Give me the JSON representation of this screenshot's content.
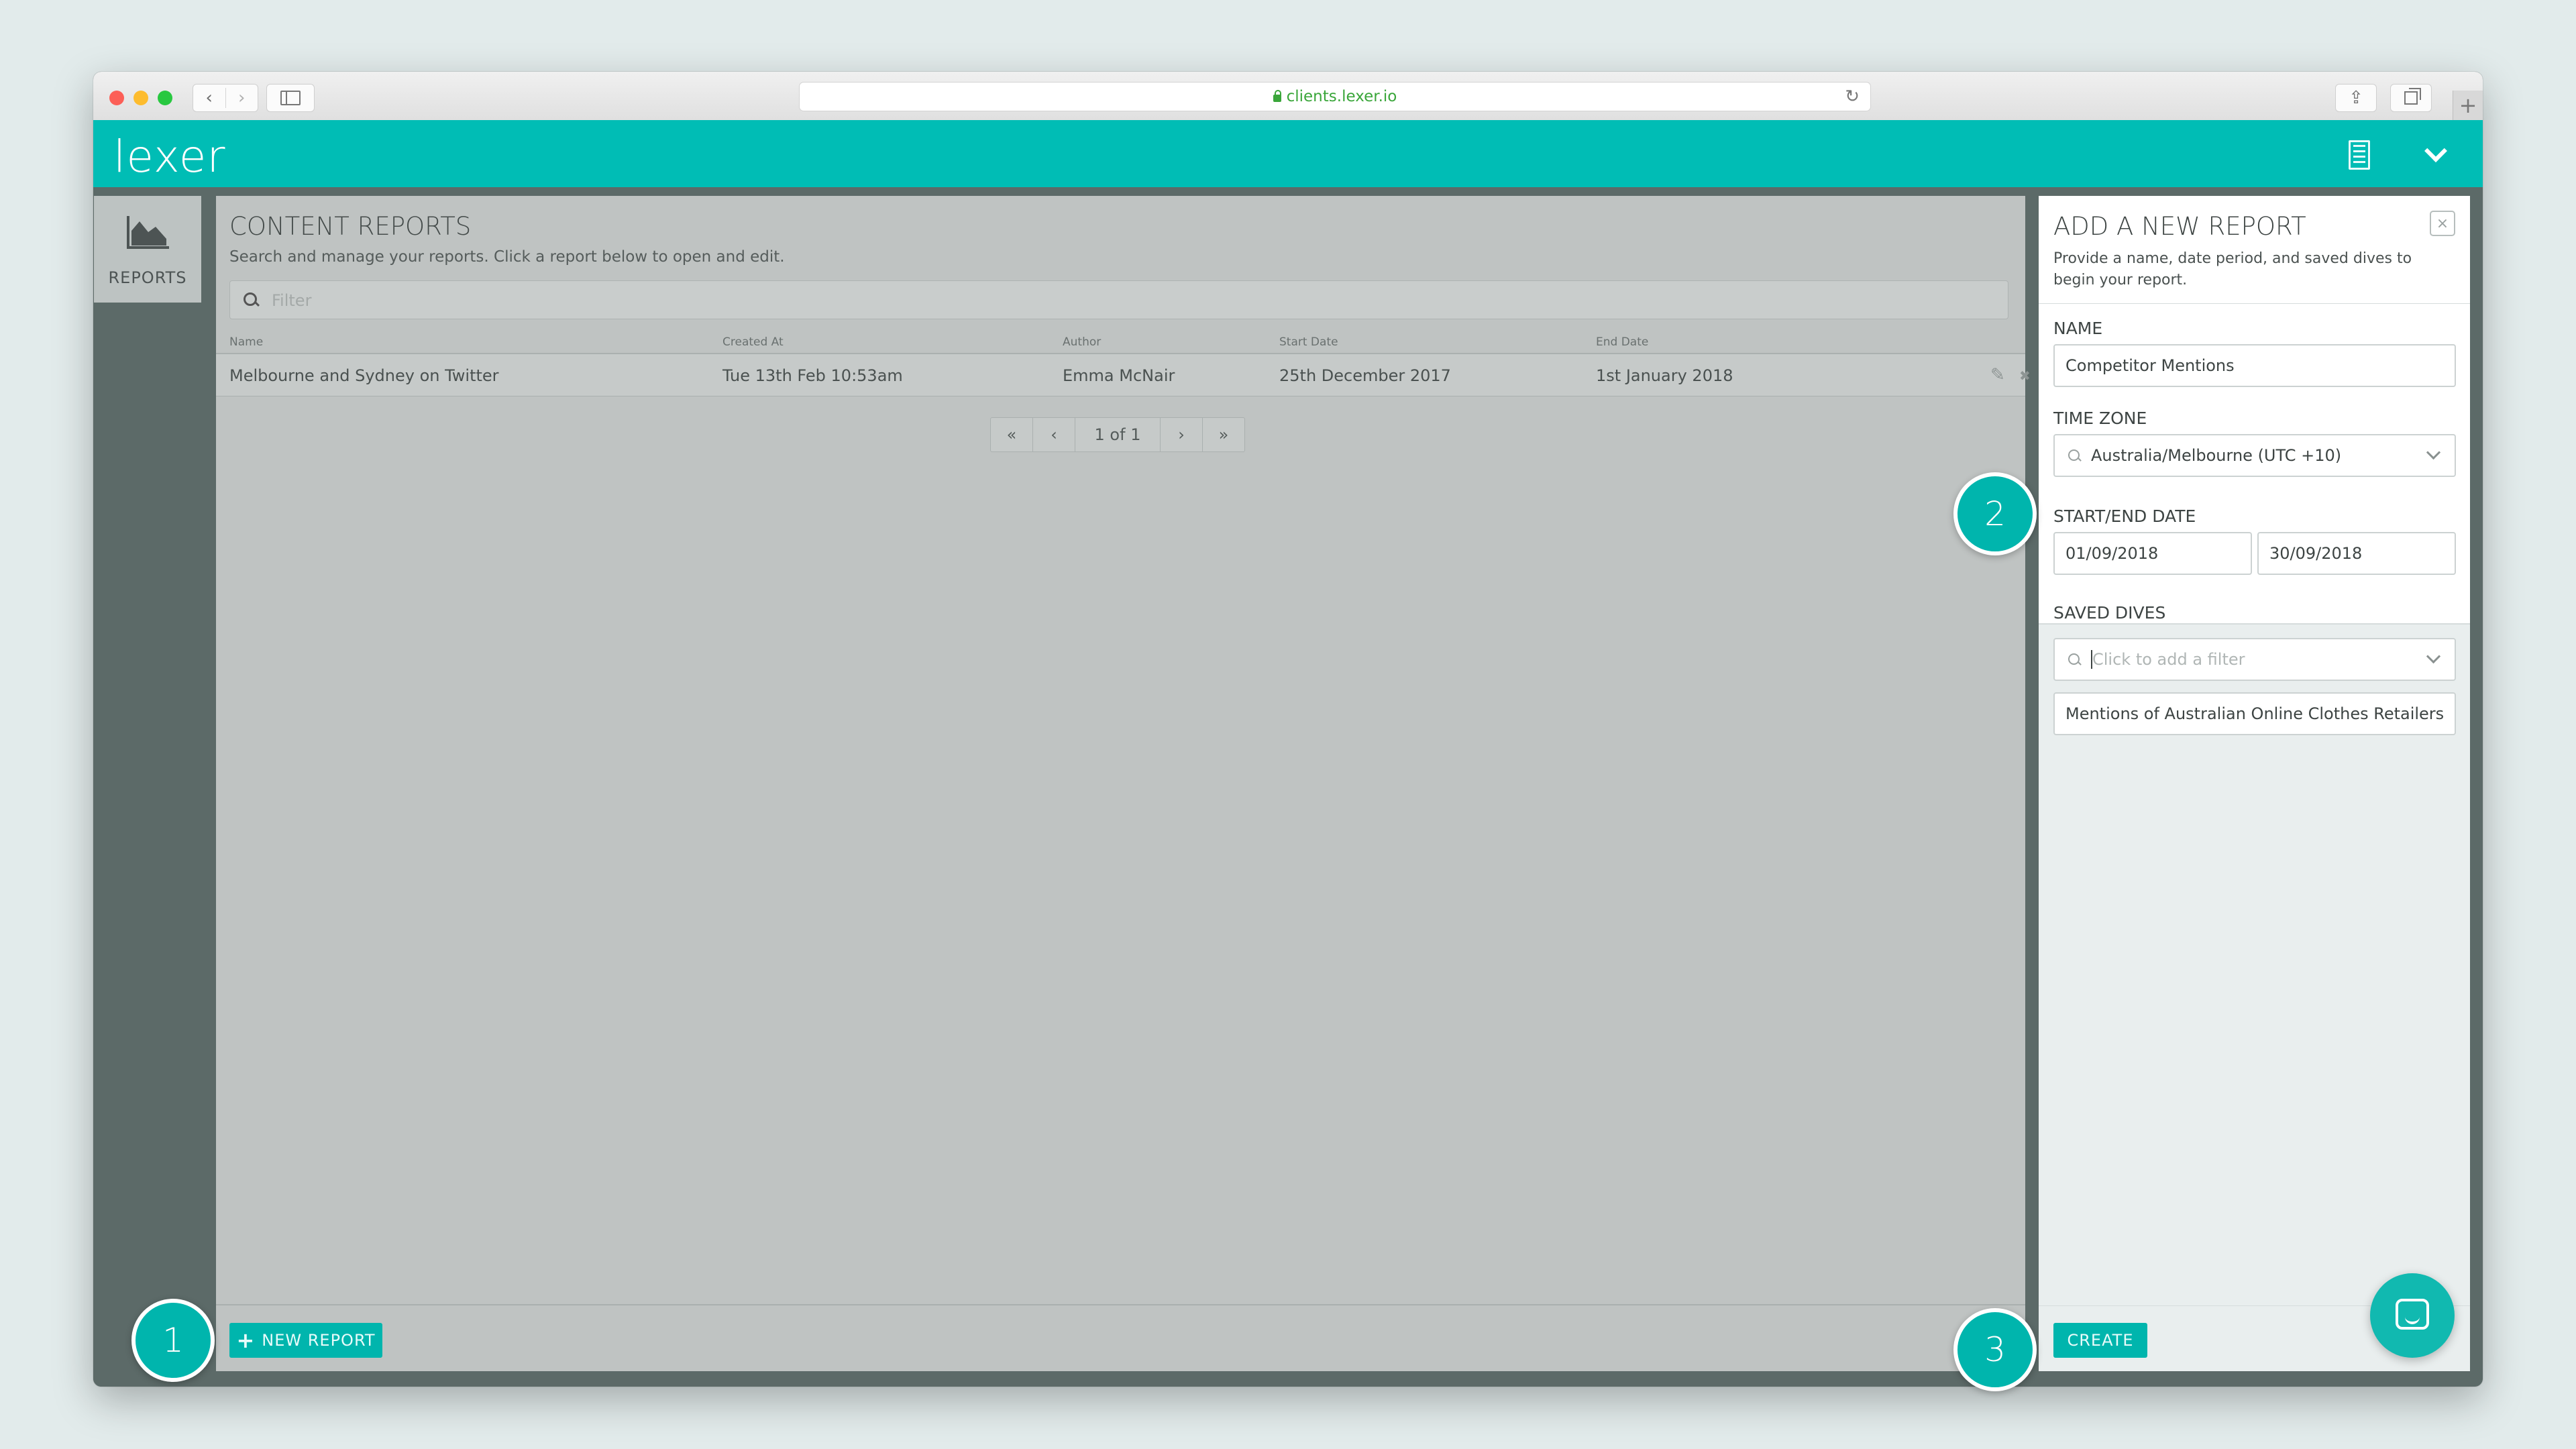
{
  "browser": {
    "url": "clients.lexer.io",
    "back_icon": "‹",
    "forward_icon": "›",
    "reload_icon": "↻",
    "share_icon": "⇪",
    "new_tab_icon": "+"
  },
  "app": {
    "logo_text": "lexer",
    "accent_color": "#00bdb5"
  },
  "nav": {
    "reports_label": "REPORTS"
  },
  "main": {
    "title": "CONTENT REPORTS",
    "subtitle": "Search and manage your reports. Click a report below to open and edit.",
    "filter_placeholder": "Filter",
    "columns": [
      "Name",
      "Created At",
      "Author",
      "Start Date",
      "End Date"
    ],
    "rows": [
      {
        "name": "Melbourne and Sydney on Twitter",
        "created_at": "Tue 13th Feb 10:53am",
        "author": "Emma McNair",
        "start_date": "25th December 2017",
        "end_date": "1st January 2018",
        "edit_icon": "✎",
        "delete_icon": "✖"
      }
    ],
    "pagination": {
      "first": "«",
      "prev": "‹",
      "page_text": "1 of 1",
      "next": "›",
      "last": "»"
    },
    "new_report_plus": "+",
    "new_report_label": "NEW REPORT"
  },
  "panel": {
    "title": "ADD A NEW REPORT",
    "description": "Provide a name, date period, and saved dives to begin your report.",
    "close_icon": "×",
    "name_label": "NAME",
    "name_value": "Competitor Mentions",
    "timezone_label": "TIME ZONE",
    "timezone_value": "Australia/Melbourne (UTC +10)",
    "date_label": "START/END DATE",
    "start_date": "01/09/2018",
    "end_date": "30/09/2018",
    "dives_label": "SAVED DIVES",
    "dives_placeholder": "Click to add a filter",
    "selected_dive": "Mentions of Australian Online Clothes Retailers",
    "create_label": "CREATE"
  },
  "steps": [
    "1",
    "2",
    "3"
  ]
}
